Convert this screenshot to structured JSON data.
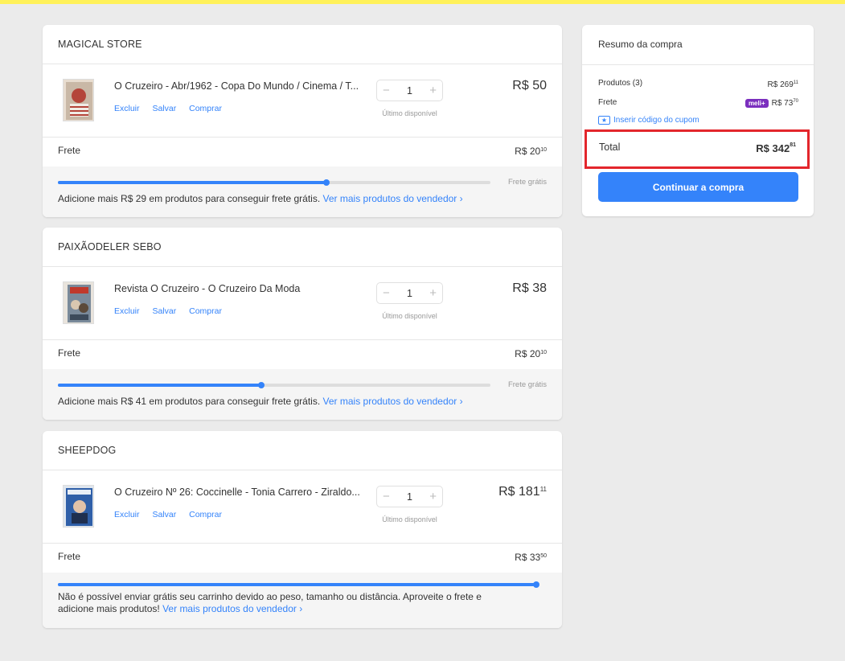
{
  "colors": {
    "accent": "#3483fa",
    "brand_yellow": "#fff159",
    "highlight_red": "#e3262c",
    "meli_purple": "#7b2fbe"
  },
  "sellers": [
    {
      "name": "MAGICAL STORE",
      "item": {
        "title": "O Cruzeiro - Abr/1962 - Copa Do Mundo / Cinema / T...",
        "actions": [
          "Excluir",
          "Salvar",
          "Comprar"
        ],
        "quantity": "1",
        "availability": "Último disponível",
        "price_main": "R$ 50",
        "price_cents": ""
      },
      "freight": {
        "label": "Frete",
        "price_main": "R$ 20",
        "price_cents": "10"
      },
      "progress": {
        "fraction": 0.62,
        "end_label": "Frete grátis",
        "message": "Adicione mais R$ 29 em produtos para conseguir frete grátis.",
        "link": "Ver mais produtos do vendedor ›"
      }
    },
    {
      "name": "PAIXÃODELER SEBO",
      "item": {
        "title": "Revista O Cruzeiro - O Cruzeiro Da Moda",
        "actions": [
          "Excluir",
          "Salvar",
          "Comprar"
        ],
        "quantity": "1",
        "availability": "Último disponível",
        "price_main": "R$ 38",
        "price_cents": ""
      },
      "freight": {
        "label": "Frete",
        "price_main": "R$ 20",
        "price_cents": "10"
      },
      "progress": {
        "fraction": 0.47,
        "end_label": "Frete grátis",
        "message": "Adicione mais R$ 41 em produtos para conseguir frete grátis.",
        "link": "Ver mais produtos do vendedor ›"
      }
    },
    {
      "name": "SHEEPDOG",
      "item": {
        "title": "O Cruzeiro Nº 26: Coccinelle - Tonia Carrero - Ziraldo...",
        "actions": [
          "Excluir",
          "Salvar",
          "Comprar"
        ],
        "quantity": "1",
        "availability": "Último disponível",
        "price_main": "R$ 181",
        "price_cents": "11"
      },
      "freight": {
        "label": "Frete",
        "price_main": "R$ 33",
        "price_cents": "50"
      },
      "progress": {
        "fraction": 1.0,
        "end_label": "",
        "message": "Não é possível enviar grátis seu carrinho devido ao peso, tamanho ou distância. Aproveite o frete e adicione mais produtos!",
        "link": "Ver mais produtos do vendedor ›"
      }
    }
  ],
  "summary": {
    "title": "Resumo da compra",
    "products_label": "Produtos (3)",
    "products_main": "R$ 269",
    "products_cents": "11",
    "freight_label": "Frete",
    "meli_badge": "meli+",
    "freight_main": "R$ 73",
    "freight_cents": "70",
    "coupon_label": "Inserir código do cupom",
    "total_label": "Total",
    "total_main": "R$ 342",
    "total_cents": "81",
    "continue_label": "Continuar a compra"
  }
}
